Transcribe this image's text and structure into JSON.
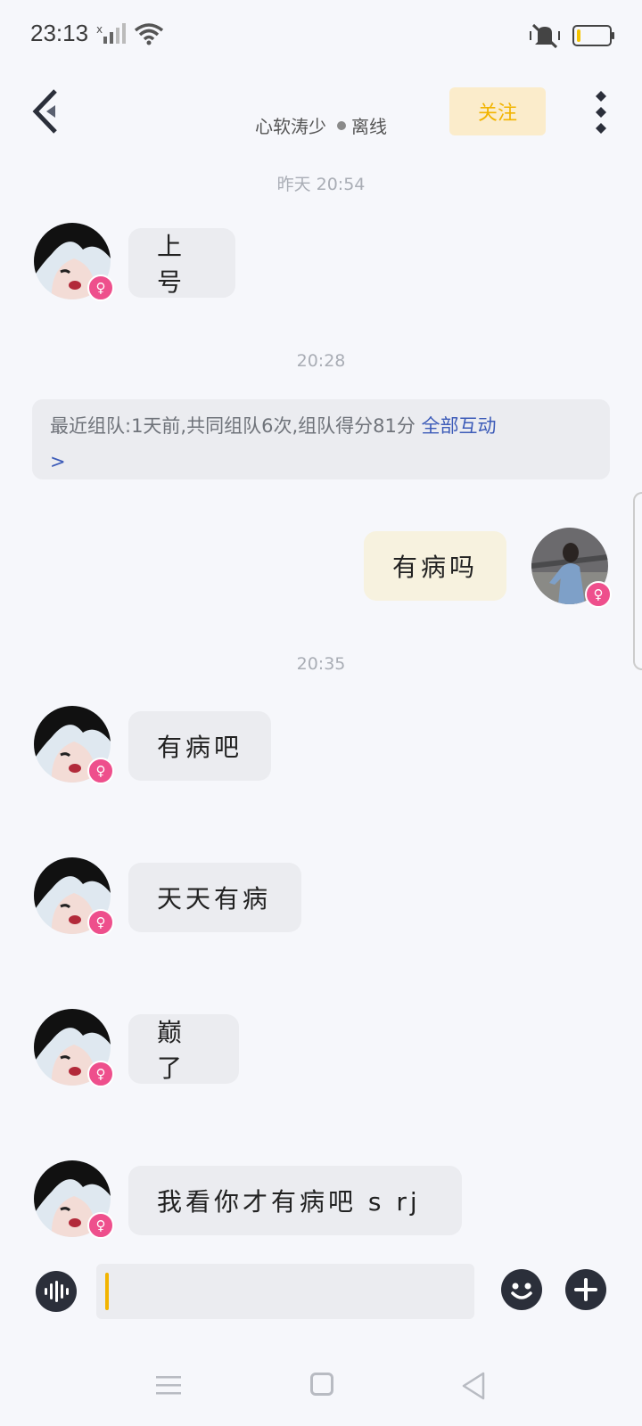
{
  "status_bar": {
    "time": "23:13"
  },
  "header": {
    "contact_name": "心软涛少",
    "online_status": "离线",
    "follow_label": "关注"
  },
  "colors": {
    "accent": "#f2b400",
    "badge": "#ee4f8c",
    "link": "#3c5bb8"
  },
  "messages": [
    {
      "type": "timestamp",
      "text": "昨天  20:54"
    },
    {
      "type": "incoming",
      "text": "上号"
    },
    {
      "type": "timestamp",
      "text": "20:28"
    },
    {
      "type": "team_card",
      "text": "最近组队:1天前,共同组队6次,组队得分81分 ",
      "link": "全部互动",
      "arrow": ">"
    },
    {
      "type": "outgoing",
      "text": "有病吗"
    },
    {
      "type": "timestamp",
      "text": "20:35"
    },
    {
      "type": "incoming",
      "text": "有病吧"
    },
    {
      "type": "incoming",
      "text": "天天有病"
    },
    {
      "type": "incoming",
      "text": "巅了"
    },
    {
      "type": "incoming",
      "text": "我看你才有病吧 s rj"
    }
  ],
  "badge_symbol": "♀",
  "icons": {
    "back": "chevron-left-icon",
    "more": "more-vertical-icon",
    "voice": "voice-wave-icon",
    "emoji": "smile-icon",
    "plus": "plus-icon"
  }
}
